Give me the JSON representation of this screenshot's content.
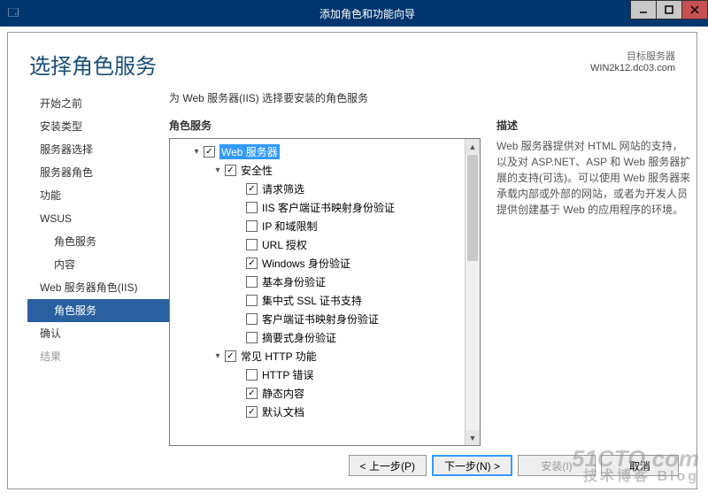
{
  "window": {
    "title": "添加角色和功能向导"
  },
  "header": {
    "title": "选择角色服务",
    "target_label": "目标服务器",
    "target_server": "WIN2k12.dc03.com"
  },
  "instruction": "为 Web 服务器(IIS) 选择要安装的角色服务",
  "nav": [
    {
      "label": "开始之前",
      "cls": ""
    },
    {
      "label": "安装类型",
      "cls": ""
    },
    {
      "label": "服务器选择",
      "cls": ""
    },
    {
      "label": "服务器角色",
      "cls": ""
    },
    {
      "label": "功能",
      "cls": ""
    },
    {
      "label": "WSUS",
      "cls": ""
    },
    {
      "label": "角色服务",
      "cls": "sub"
    },
    {
      "label": "内容",
      "cls": "sub"
    },
    {
      "label": "Web 服务器角色(IIS)",
      "cls": ""
    },
    {
      "label": "角色服务",
      "cls": "sub active"
    },
    {
      "label": "确认",
      "cls": ""
    },
    {
      "label": "结果",
      "cls": "dim"
    }
  ],
  "tree_header": "角色服务",
  "desc_header": "描述",
  "description": "Web 服务器提供对 HTML 网站的支持，以及对 ASP.NET、ASP 和 Web 服务器扩展的支持(可选)。可以使用 Web 服务器来承载内部或外部的网站，或者为开发人员提供创建基于 Web 的应用程序的环境。",
  "tree": [
    {
      "indent": 1,
      "exp": "▾",
      "checked": true,
      "label": "Web 服务器",
      "hl": true
    },
    {
      "indent": 2,
      "exp": "▾",
      "checked": true,
      "label": "安全性"
    },
    {
      "indent": 3,
      "exp": "",
      "checked": true,
      "label": "请求筛选"
    },
    {
      "indent": 3,
      "exp": "",
      "checked": false,
      "label": "IIS 客户端证书映射身份验证"
    },
    {
      "indent": 3,
      "exp": "",
      "checked": false,
      "label": "IP 和域限制"
    },
    {
      "indent": 3,
      "exp": "",
      "checked": false,
      "label": "URL 授权"
    },
    {
      "indent": 3,
      "exp": "",
      "checked": true,
      "label": "Windows 身份验证"
    },
    {
      "indent": 3,
      "exp": "",
      "checked": false,
      "label": "基本身份验证"
    },
    {
      "indent": 3,
      "exp": "",
      "checked": false,
      "label": "集中式 SSL 证书支持"
    },
    {
      "indent": 3,
      "exp": "",
      "checked": false,
      "label": "客户端证书映射身份验证"
    },
    {
      "indent": 3,
      "exp": "",
      "checked": false,
      "label": "摘要式身份验证"
    },
    {
      "indent": 2,
      "exp": "▾",
      "checked": true,
      "label": "常见 HTTP 功能"
    },
    {
      "indent": 3,
      "exp": "",
      "checked": false,
      "label": "HTTP 错误"
    },
    {
      "indent": 3,
      "exp": "",
      "checked": true,
      "label": "静态内容"
    },
    {
      "indent": 3,
      "exp": "",
      "checked": true,
      "label": "默认文档"
    }
  ],
  "buttons": {
    "prev": "< 上一步(P)",
    "next": "下一步(N) >",
    "install": "安装(I)",
    "cancel": "取消"
  },
  "watermark": {
    "main": "51CTO.com",
    "sub": "技术博客  Blog"
  }
}
